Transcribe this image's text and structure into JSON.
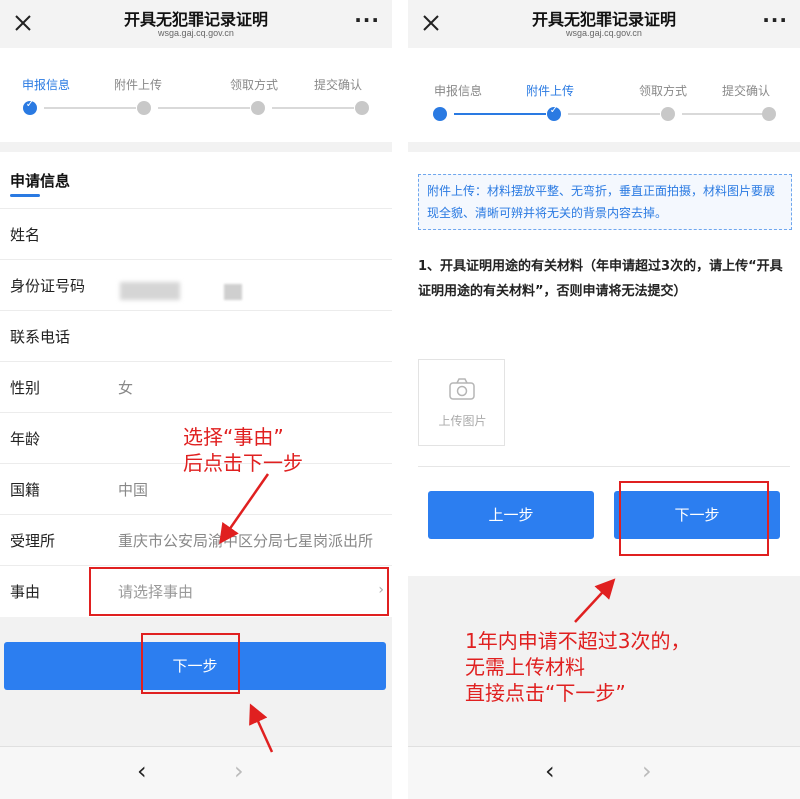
{
  "nav": {
    "title": "开具无犯罪记录证明",
    "url": "wsga.gaj.cq.gov.cn",
    "more": "···"
  },
  "steps": [
    "申报信息",
    "附件上传",
    "领取方式",
    "提交确认"
  ],
  "left": {
    "section_title": "申请信息",
    "rows": [
      {
        "label": "姓名",
        "value": ""
      },
      {
        "label": "身份证号码",
        "value": ""
      },
      {
        "label": "联系电话",
        "value": ""
      },
      {
        "label": "性别",
        "value": "女"
      },
      {
        "label": "年龄",
        "value": ""
      },
      {
        "label": "国籍",
        "value": "中国"
      },
      {
        "label": "受理所",
        "value": "重庆市公安局渝中区分局七星岗派出所"
      },
      {
        "label": "事由",
        "placeholder": "请选择事由"
      }
    ],
    "next_button": "下一步",
    "annotation_line1": "选择“事由”",
    "annotation_line2": "后点击下一步"
  },
  "right": {
    "notice": "附件上传：材料摆放平整、无弯折，垂直正面拍摄，材料图片要展现全貌、清晰可辨并将无关的背景内容去掉。",
    "requirement": "1、开具证明用途的有关材料（年申请超过3次的，请上传“开具证明用途的有关材料”，否则申请将无法提交）",
    "upload_label": "上传图片",
    "prev_button": "上一步",
    "next_button": "下一步",
    "annotation_line1": "1年内申请不超过3次的，",
    "annotation_line2": "无需上传材料",
    "annotation_line3": "直接点击“下一步”"
  },
  "toolbar": {
    "back": "‹",
    "forward": "›"
  },
  "colors": {
    "accent": "#2c7ef0",
    "annotation": "#e02020"
  }
}
